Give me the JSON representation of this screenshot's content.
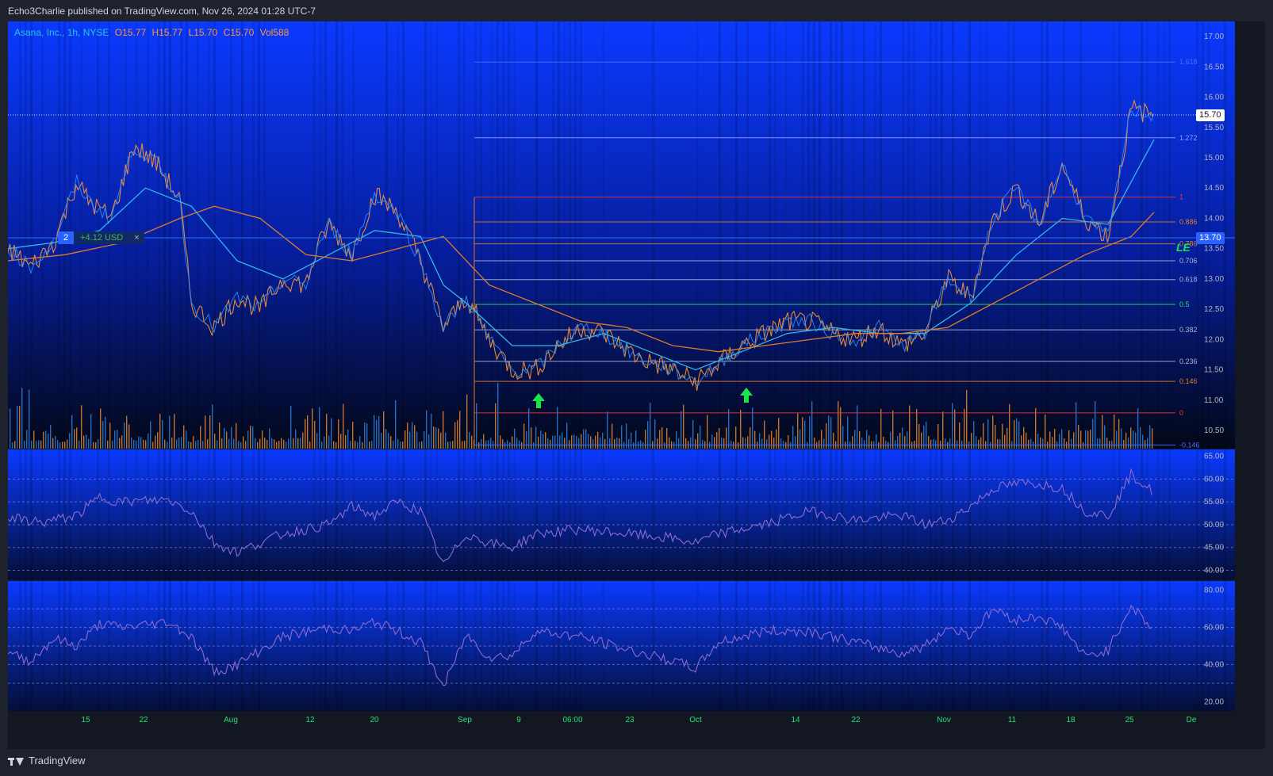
{
  "header": {
    "publish_text": "Echo3Charlie published on TradingView.com, Nov 26, 2024 01:28 UTC-7"
  },
  "footer": {
    "brand": "TradingView"
  },
  "legend": {
    "symbol": "Asana, Inc., 1h, NYSE",
    "open": "O15.77",
    "high": "H15.77",
    "low": "L15.70",
    "close": "C15.70",
    "volume": "Vol588"
  },
  "position_tool": {
    "qty": "2",
    "pnl": "+4.12 USD",
    "close_glyph": "×"
  },
  "price_tags": {
    "last": "15.70",
    "entry": "13.70"
  },
  "le_label": "LE",
  "colors": {
    "background_top": "#0a3aff",
    "background_bottom": "#030818",
    "candle_up": "#2f8df5",
    "candle_down": "#ff9632",
    "ema_fast": "#34b8e8",
    "ema_slow": "#e07a2a",
    "rsi_line": "#8a6cd0",
    "fib_mid": "#29e05a",
    "fib_zero": "#e53935",
    "signal_arrow": "#19e54a"
  },
  "chart_data": [
    {
      "type": "line",
      "panel": "price",
      "title": "Asana, Inc., 1h, NYSE",
      "y_axis_ticks": [
        "17.00",
        "16.50",
        "16.00",
        "15.50",
        "15.00",
        "14.50",
        "14.00",
        "13.50",
        "13.00",
        "12.50",
        "12.00",
        "11.50",
        "11.00",
        "10.50"
      ],
      "ylim": [
        10.2,
        17.25
      ],
      "x_axis_ticks": [
        "15",
        "22",
        "Aug",
        "12",
        "20",
        "Sep",
        "9",
        "06:00",
        "23",
        "Oct",
        "14",
        "22",
        "Nov",
        "11",
        "18",
        "25",
        "De"
      ],
      "series": [
        {
          "name": "",
          "kind": "close",
          "x": [
            0,
            2,
            4,
            6,
            7,
            9,
            11,
            13,
            15,
            16,
            18,
            20,
            22,
            24,
            26,
            27,
            28,
            30,
            32,
            34,
            36,
            38,
            40,
            42,
            44,
            46,
            48,
            50,
            52,
            55,
            58,
            60,
            62,
            64,
            66,
            68,
            70,
            72,
            74,
            76,
            78,
            80,
            82,
            84,
            86,
            88,
            90,
            92,
            94,
            96,
            98,
            100
          ],
          "y": [
            13.5,
            13.2,
            13.6,
            14.6,
            14.3,
            14.0,
            15.2,
            14.9,
            14.3,
            12.6,
            12.2,
            12.7,
            12.5,
            13.0,
            12.9,
            13.5,
            13.9,
            13.4,
            14.4,
            14.1,
            13.3,
            12.2,
            12.7,
            12.0,
            11.5,
            11.5,
            11.9,
            12.2,
            12.1,
            11.7,
            11.5,
            11.3,
            11.6,
            11.9,
            12.1,
            12.3,
            12.3,
            12.1,
            12.0,
            12.2,
            11.9,
            12.1,
            13.0,
            12.7,
            14.0,
            14.5,
            13.9,
            14.9,
            14.0,
            13.7,
            15.8,
            15.7
          ]
        },
        {
          "name": "",
          "kind": "ema_fast",
          "x": [
            0,
            4,
            8,
            12,
            16,
            20,
            24,
            28,
            32,
            36,
            38,
            40,
            44,
            48,
            52,
            56,
            60,
            64,
            68,
            72,
            76,
            80,
            84,
            88,
            92,
            96,
            100
          ],
          "y": [
            13.5,
            13.6,
            13.8,
            14.5,
            14.2,
            13.3,
            13.0,
            13.4,
            13.8,
            13.7,
            12.9,
            12.6,
            11.9,
            11.9,
            12.1,
            11.8,
            11.5,
            11.8,
            12.1,
            12.2,
            12.1,
            12.1,
            12.6,
            13.4,
            14.0,
            13.9,
            15.3
          ]
        },
        {
          "name": "",
          "kind": "ema_slow",
          "x": [
            0,
            5,
            10,
            15,
            18,
            22,
            26,
            30,
            34,
            38,
            42,
            46,
            50,
            54,
            58,
            62,
            66,
            70,
            74,
            78,
            82,
            86,
            90,
            94,
            98,
            100
          ],
          "y": [
            13.3,
            13.4,
            13.6,
            14.0,
            14.2,
            14.0,
            13.4,
            13.3,
            13.5,
            13.7,
            12.9,
            12.6,
            12.3,
            12.2,
            11.9,
            11.8,
            11.9,
            12.0,
            12.1,
            12.1,
            12.2,
            12.6,
            13.0,
            13.4,
            13.7,
            14.1
          ]
        }
      ],
      "fibonacci": {
        "levels": [
          "1.618",
          "1.272",
          "1",
          "0.886",
          "0.786",
          "0.706",
          "0.618",
          "0.5",
          "0.382",
          "0.236",
          "0.146",
          "0",
          "-0.146"
        ],
        "prices": [
          16.58,
          15.33,
          14.35,
          13.94,
          13.58,
          13.3,
          12.99,
          12.58,
          12.16,
          11.64,
          11.31,
          10.79,
          10.26
        ]
      },
      "last_price": 15.7,
      "entry_price": 13.7
    },
    {
      "type": "line",
      "panel": "oscillator-1",
      "y_axis_ticks": [
        "65.00",
        "60.00",
        "55.00",
        "50.00",
        "45.00",
        "40.00"
      ],
      "ylim": [
        38,
        66.5
      ],
      "levels": [
        60,
        55,
        50,
        45,
        40
      ],
      "series": [
        {
          "name": "",
          "x": [
            0,
            3,
            6,
            8,
            10,
            14,
            16,
            18,
            20,
            24,
            28,
            30,
            32,
            34,
            36,
            38,
            40,
            42,
            44,
            46,
            50,
            54,
            58,
            60,
            62,
            66,
            70,
            74,
            78,
            80,
            82,
            84,
            86,
            88,
            90,
            92,
            94,
            96,
            98,
            100
          ],
          "y": [
            51.5,
            50.5,
            52,
            56,
            55,
            55.5,
            53,
            46,
            44,
            48,
            50,
            54,
            52,
            55,
            53,
            41,
            48,
            46,
            45,
            48,
            49,
            48,
            47,
            46,
            48,
            50,
            53,
            51,
            52,
            50,
            51,
            54,
            58,
            59,
            59,
            58,
            53,
            52,
            61,
            57
          ]
        }
      ]
    },
    {
      "type": "line",
      "panel": "oscillator-2",
      "y_axis_ticks": [
        "80.00",
        "60.00",
        "40.00",
        "20.00"
      ],
      "ylim": [
        15,
        85
      ],
      "levels": [
        70,
        60,
        50,
        40,
        30
      ],
      "series": [
        {
          "name": "",
          "x": [
            0,
            2,
            4,
            6,
            8,
            10,
            14,
            16,
            18,
            20,
            24,
            28,
            30,
            32,
            34,
            36,
            38,
            40,
            42,
            44,
            46,
            50,
            54,
            58,
            60,
            62,
            66,
            70,
            74,
            78,
            80,
            82,
            84,
            86,
            88,
            90,
            92,
            94,
            96,
            98,
            100
          ],
          "y": [
            46,
            42,
            54,
            50,
            62,
            60,
            63,
            55,
            36,
            40,
            55,
            60,
            58,
            63,
            58,
            52,
            28,
            56,
            44,
            45,
            58,
            55,
            48,
            42,
            38,
            52,
            58,
            58,
            52,
            46,
            50,
            60,
            56,
            70,
            64,
            66,
            60,
            44,
            48,
            72,
            58
          ]
        }
      ]
    }
  ]
}
